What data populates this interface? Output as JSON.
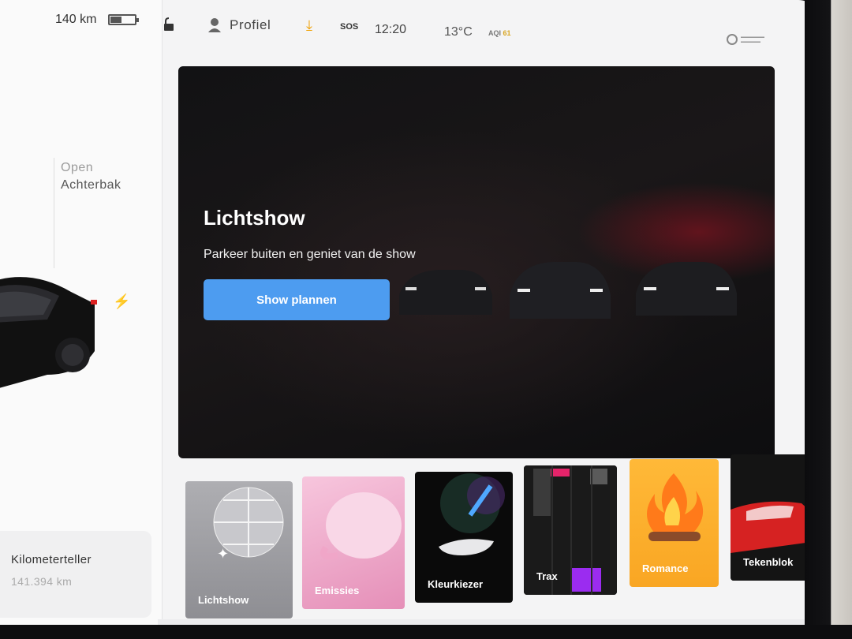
{
  "car": {
    "range": "140 km",
    "battery_level": 0.45,
    "trunk_status": "Open",
    "trunk_label": "Achterbak",
    "odometer_title": "Kilometerteller",
    "odometer_value": "141.394 km"
  },
  "status": {
    "profile_label": "Profiel",
    "sos": "SOS",
    "time": "12:20",
    "temperature": "13°C",
    "aqi_label": "AQI",
    "aqi_value": "61"
  },
  "hero": {
    "title": "Lichtshow",
    "subtitle": "Parkeer buiten en geniet van de show",
    "button_label": "Show plannen"
  },
  "apps": [
    {
      "label": "Lichtshow",
      "icon": "disco-ball-icon"
    },
    {
      "label": "Emissies",
      "icon": "whoopee-cushion-icon"
    },
    {
      "label": "Kleurkiezer",
      "icon": "color-dropper-icon"
    },
    {
      "label": "Trax",
      "icon": "piano-keys-icon"
    },
    {
      "label": "Romance",
      "icon": "fireplace-icon"
    },
    {
      "label": "Tekenblok",
      "icon": "sketchpad-icon"
    }
  ],
  "colors": {
    "accent": "#4d9cf0",
    "download": "#f0a000",
    "aqi": "#d9a520"
  }
}
